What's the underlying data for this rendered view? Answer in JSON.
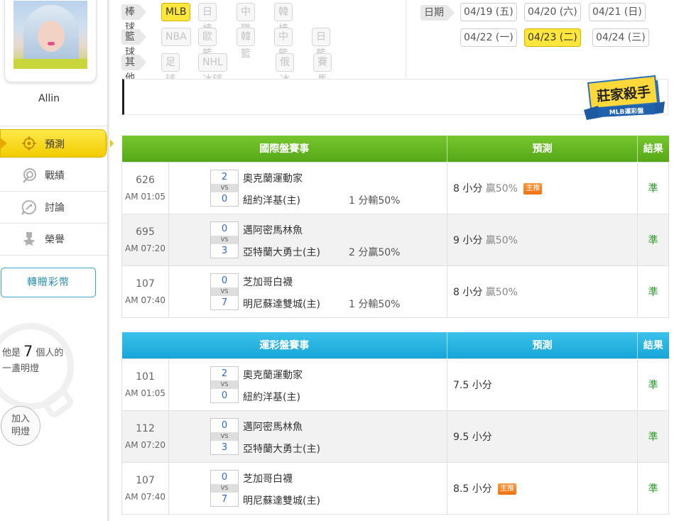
{
  "sidebar": {
    "username": "Allin",
    "nav": [
      {
        "label": "預測",
        "icon": "target-icon"
      },
      {
        "label": "戰績",
        "icon": "record-icon"
      },
      {
        "label": "討論",
        "icon": "discussion-icon"
      },
      {
        "label": "榮譽",
        "icon": "honor-medal-icon"
      }
    ],
    "gift_button": "轉贈彩幣",
    "light": {
      "prefix": "他是",
      "count": "7",
      "suffix": "個人的",
      "line2": "一盞明燈"
    },
    "join_light": {
      "line1": "加入",
      "line2": "明燈"
    }
  },
  "filters": {
    "rows": [
      {
        "category": "棒球",
        "leagues": [
          {
            "label": "MLB",
            "active": true
          },
          {
            "label": "日棒",
            "active": false
          },
          {
            "label": "中職",
            "active": false
          },
          {
            "label": "韓棒",
            "active": false
          }
        ]
      },
      {
        "category": "籃球",
        "leagues": [
          {
            "label": "NBA",
            "active": false
          },
          {
            "label": "歐籃",
            "active": false
          },
          {
            "label": "韓籃",
            "active": false
          },
          {
            "label": "中籃",
            "active": false
          },
          {
            "label": "日籃",
            "active": false
          }
        ]
      },
      {
        "category": "其他",
        "leagues": [
          {
            "label": "足球",
            "active": false
          },
          {
            "label": "NHL冰球",
            "active": false
          },
          {
            "label": "俄冰",
            "active": false
          },
          {
            "label": "賽馬",
            "active": false
          }
        ]
      }
    ],
    "date_label": "日期",
    "dates": [
      {
        "label": "04/19 (五)",
        "active": false
      },
      {
        "label": "04/20 (六)",
        "active": false
      },
      {
        "label": "04/21 (日)",
        "active": false
      },
      {
        "label": "04/22 (一)",
        "active": false
      },
      {
        "label": "04/23 (二)",
        "active": true
      },
      {
        "label": "04/24 (三)",
        "active": false
      }
    ]
  },
  "badge": {
    "line1": "莊家殺手",
    "line2": "MLB運彩盤"
  },
  "tables": [
    {
      "theme": "green",
      "headers": [
        "國際盤賽事",
        "預測",
        "結果"
      ],
      "rows": [
        {
          "id": "626",
          "time": "AM 01:05",
          "away_score": "2",
          "home_score": "0",
          "vs": "VS",
          "away": "奧克蘭運動家",
          "home": "紐約洋基(主)",
          "spread": "1 分輸50%",
          "pick": "8 小分",
          "rate": "贏50%",
          "tag": "主推",
          "result": "準"
        },
        {
          "id": "695",
          "time": "AM 07:20",
          "away_score": "0",
          "home_score": "3",
          "vs": "VS",
          "away": "邁阿密馬林魚",
          "home": "亞特蘭大勇士(主)",
          "spread": "2 分贏50%",
          "pick": "9 小分",
          "rate": "贏50%",
          "tag": "",
          "result": "準"
        },
        {
          "id": "107",
          "time": "AM 07:40",
          "away_score": "0",
          "home_score": "7",
          "vs": "VS",
          "away": "芝加哥白襪",
          "home": "明尼蘇達雙城(主)",
          "spread": "1 分輸50%",
          "pick": "8 小分",
          "rate": "贏50%",
          "tag": "",
          "result": "準"
        }
      ]
    },
    {
      "theme": "blue",
      "headers": [
        "運彩盤賽事",
        "預測",
        "結果"
      ],
      "rows": [
        {
          "id": "101",
          "time": "AM 01:05",
          "away_score": "2",
          "home_score": "0",
          "vs": "VS",
          "away": "奧克蘭運動家",
          "home": "紐約洋基(主)",
          "spread": "",
          "pick": "7.5 小分",
          "rate": "",
          "tag": "",
          "result": "準"
        },
        {
          "id": "112",
          "time": "AM 07:20",
          "away_score": "0",
          "home_score": "3",
          "vs": "VS",
          "away": "邁阿密馬林魚",
          "home": "亞特蘭大勇士(主)",
          "spread": "",
          "pick": "9.5 小分",
          "rate": "",
          "tag": "",
          "result": "準"
        },
        {
          "id": "107",
          "time": "AM 07:40",
          "away_score": "0",
          "home_score": "7",
          "vs": "VS",
          "away": "芝加哥白襪",
          "home": "明尼蘇達雙城(主)",
          "spread": "",
          "pick": "8.5 小分",
          "rate": "",
          "tag": "主推",
          "result": "準"
        }
      ]
    }
  ],
  "colors": {
    "accent_yellow": "#ffe63c",
    "green_header": "#5bb020",
    "blue_header": "#1fa9dc",
    "result_green": "#2a9a2a",
    "tag_orange": "#f07a18"
  }
}
